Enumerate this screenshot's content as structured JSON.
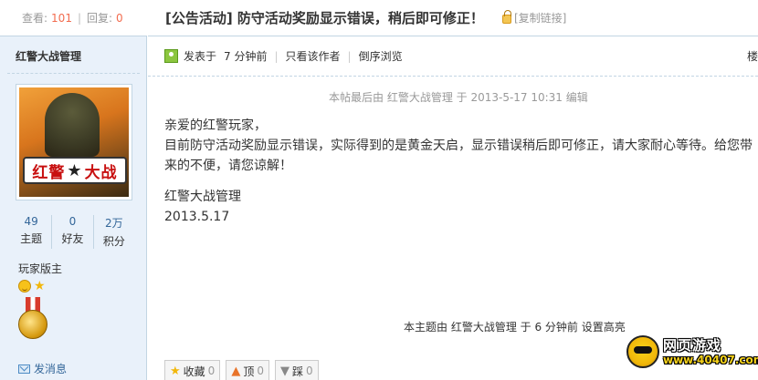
{
  "sidebar": {
    "views_label": "查看:",
    "views": "101",
    "replies_label": "回复:",
    "replies": "0",
    "author": "红警大战管理",
    "avatar_logo_left": "红警",
    "avatar_logo_right": "大战",
    "stats": [
      {
        "value": "49",
        "label": "主题"
      },
      {
        "value": "0",
        "label": "好友"
      },
      {
        "value": "2万",
        "label": "积分"
      }
    ],
    "rank": "玩家版主",
    "send_message": "发消息"
  },
  "post": {
    "title": "[公告活动] 防守活动奖励显示错误，稍后即可修正！",
    "copy_link": "[复制链接]",
    "posted_label": "发表于",
    "posted_time": "7 分钟前",
    "only_author": "只看该作者",
    "reverse_view": "倒序浏览",
    "floor": "楼",
    "edited_note": "本帖最后由  红警大战管理  于  2013-5-17 10:31 编辑",
    "content_lines": [
      "亲爱的红警玩家，",
      "目前防守活动奖励显示错误，实际得到的是黄金天启，显示错误稍后即可修正，请大家耐心等待。给您带来的不便，请您谅解！"
    ],
    "signature_name": "红警大战管理",
    "signature_date": "2013.5.17",
    "bottom_note": "本主题由  红警大战管理  于  6 分钟前  设置高亮"
  },
  "actions": [
    {
      "label": "收藏",
      "count": "0",
      "icon": "star-icon"
    },
    {
      "label": "顶",
      "count": "0",
      "icon": "thumbs-up-icon"
    },
    {
      "label": "踩",
      "count": "0",
      "icon": "thumbs-down-icon"
    }
  ],
  "watermark": {
    "title": "网页游戏",
    "url": "www.40407.com"
  }
}
